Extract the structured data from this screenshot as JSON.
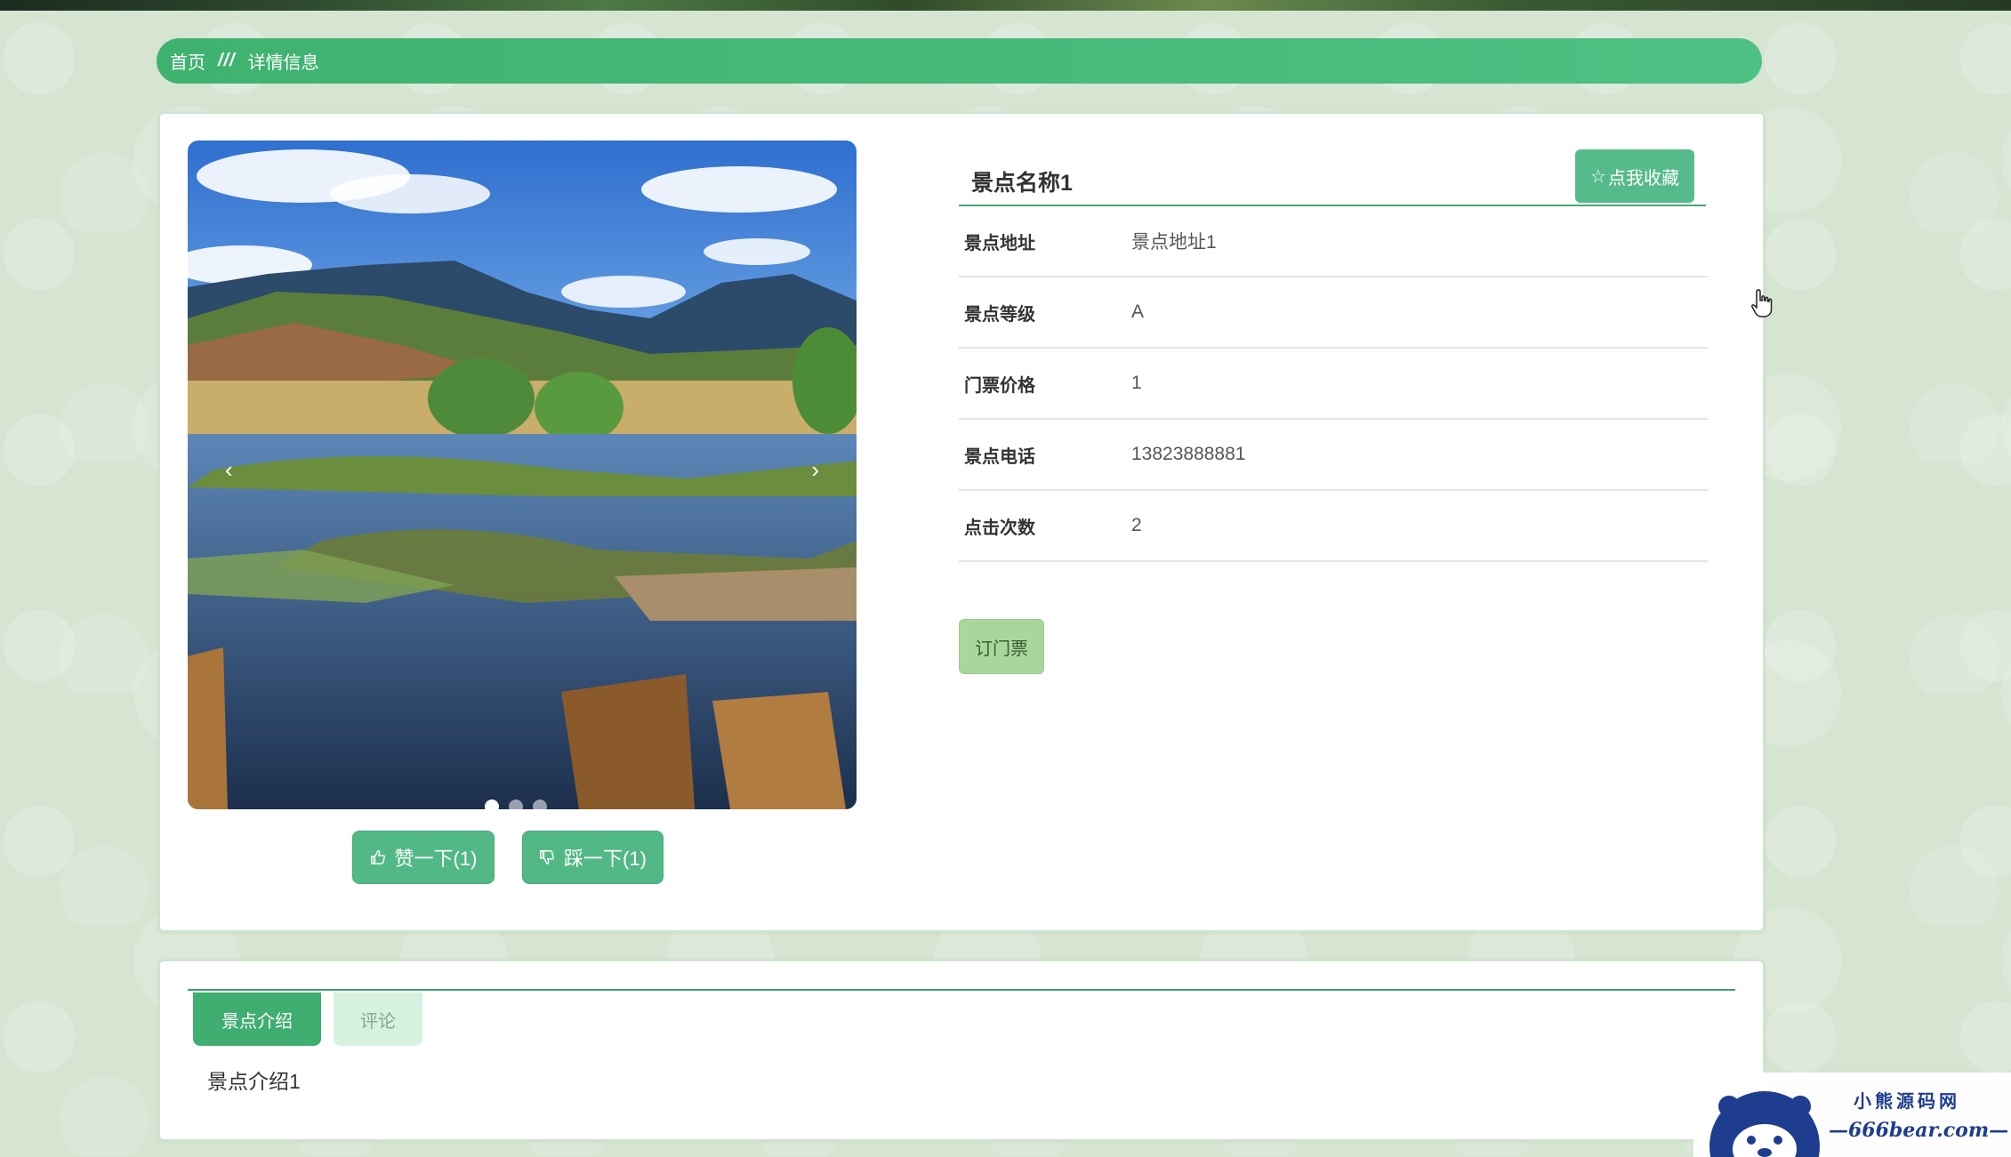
{
  "breadcrumb": {
    "home": "首页",
    "separator": "///",
    "current": "详情信息"
  },
  "detail": {
    "name": "景点名称1",
    "favorite_label": "点我收藏",
    "fields": [
      {
        "label": "景点地址",
        "value": "景点地址1"
      },
      {
        "label": "景点等级",
        "value": "A"
      },
      {
        "label": "门票价格",
        "value": "1"
      },
      {
        "label": "景点电话",
        "value": "13823888881"
      },
      {
        "label": "点击次数",
        "value": "2"
      }
    ],
    "book_label": "订门票"
  },
  "carousel": {
    "prev": "‹",
    "next": "›",
    "slide_count": 3,
    "active_index": 0
  },
  "votes": {
    "like_label": "赞一下(1)",
    "dislike_label": "踩一下(1)"
  },
  "tabs": [
    {
      "label": "景点介绍",
      "active": true
    },
    {
      "label": "评论",
      "active": false
    }
  ],
  "tab_content": "景点介绍1",
  "watermark": {
    "title": "小熊源码网",
    "url": "—666bear.com—"
  },
  "colors": {
    "accent": "#3fb26f",
    "button": "#52b986",
    "book_button": "#a8d79b"
  }
}
